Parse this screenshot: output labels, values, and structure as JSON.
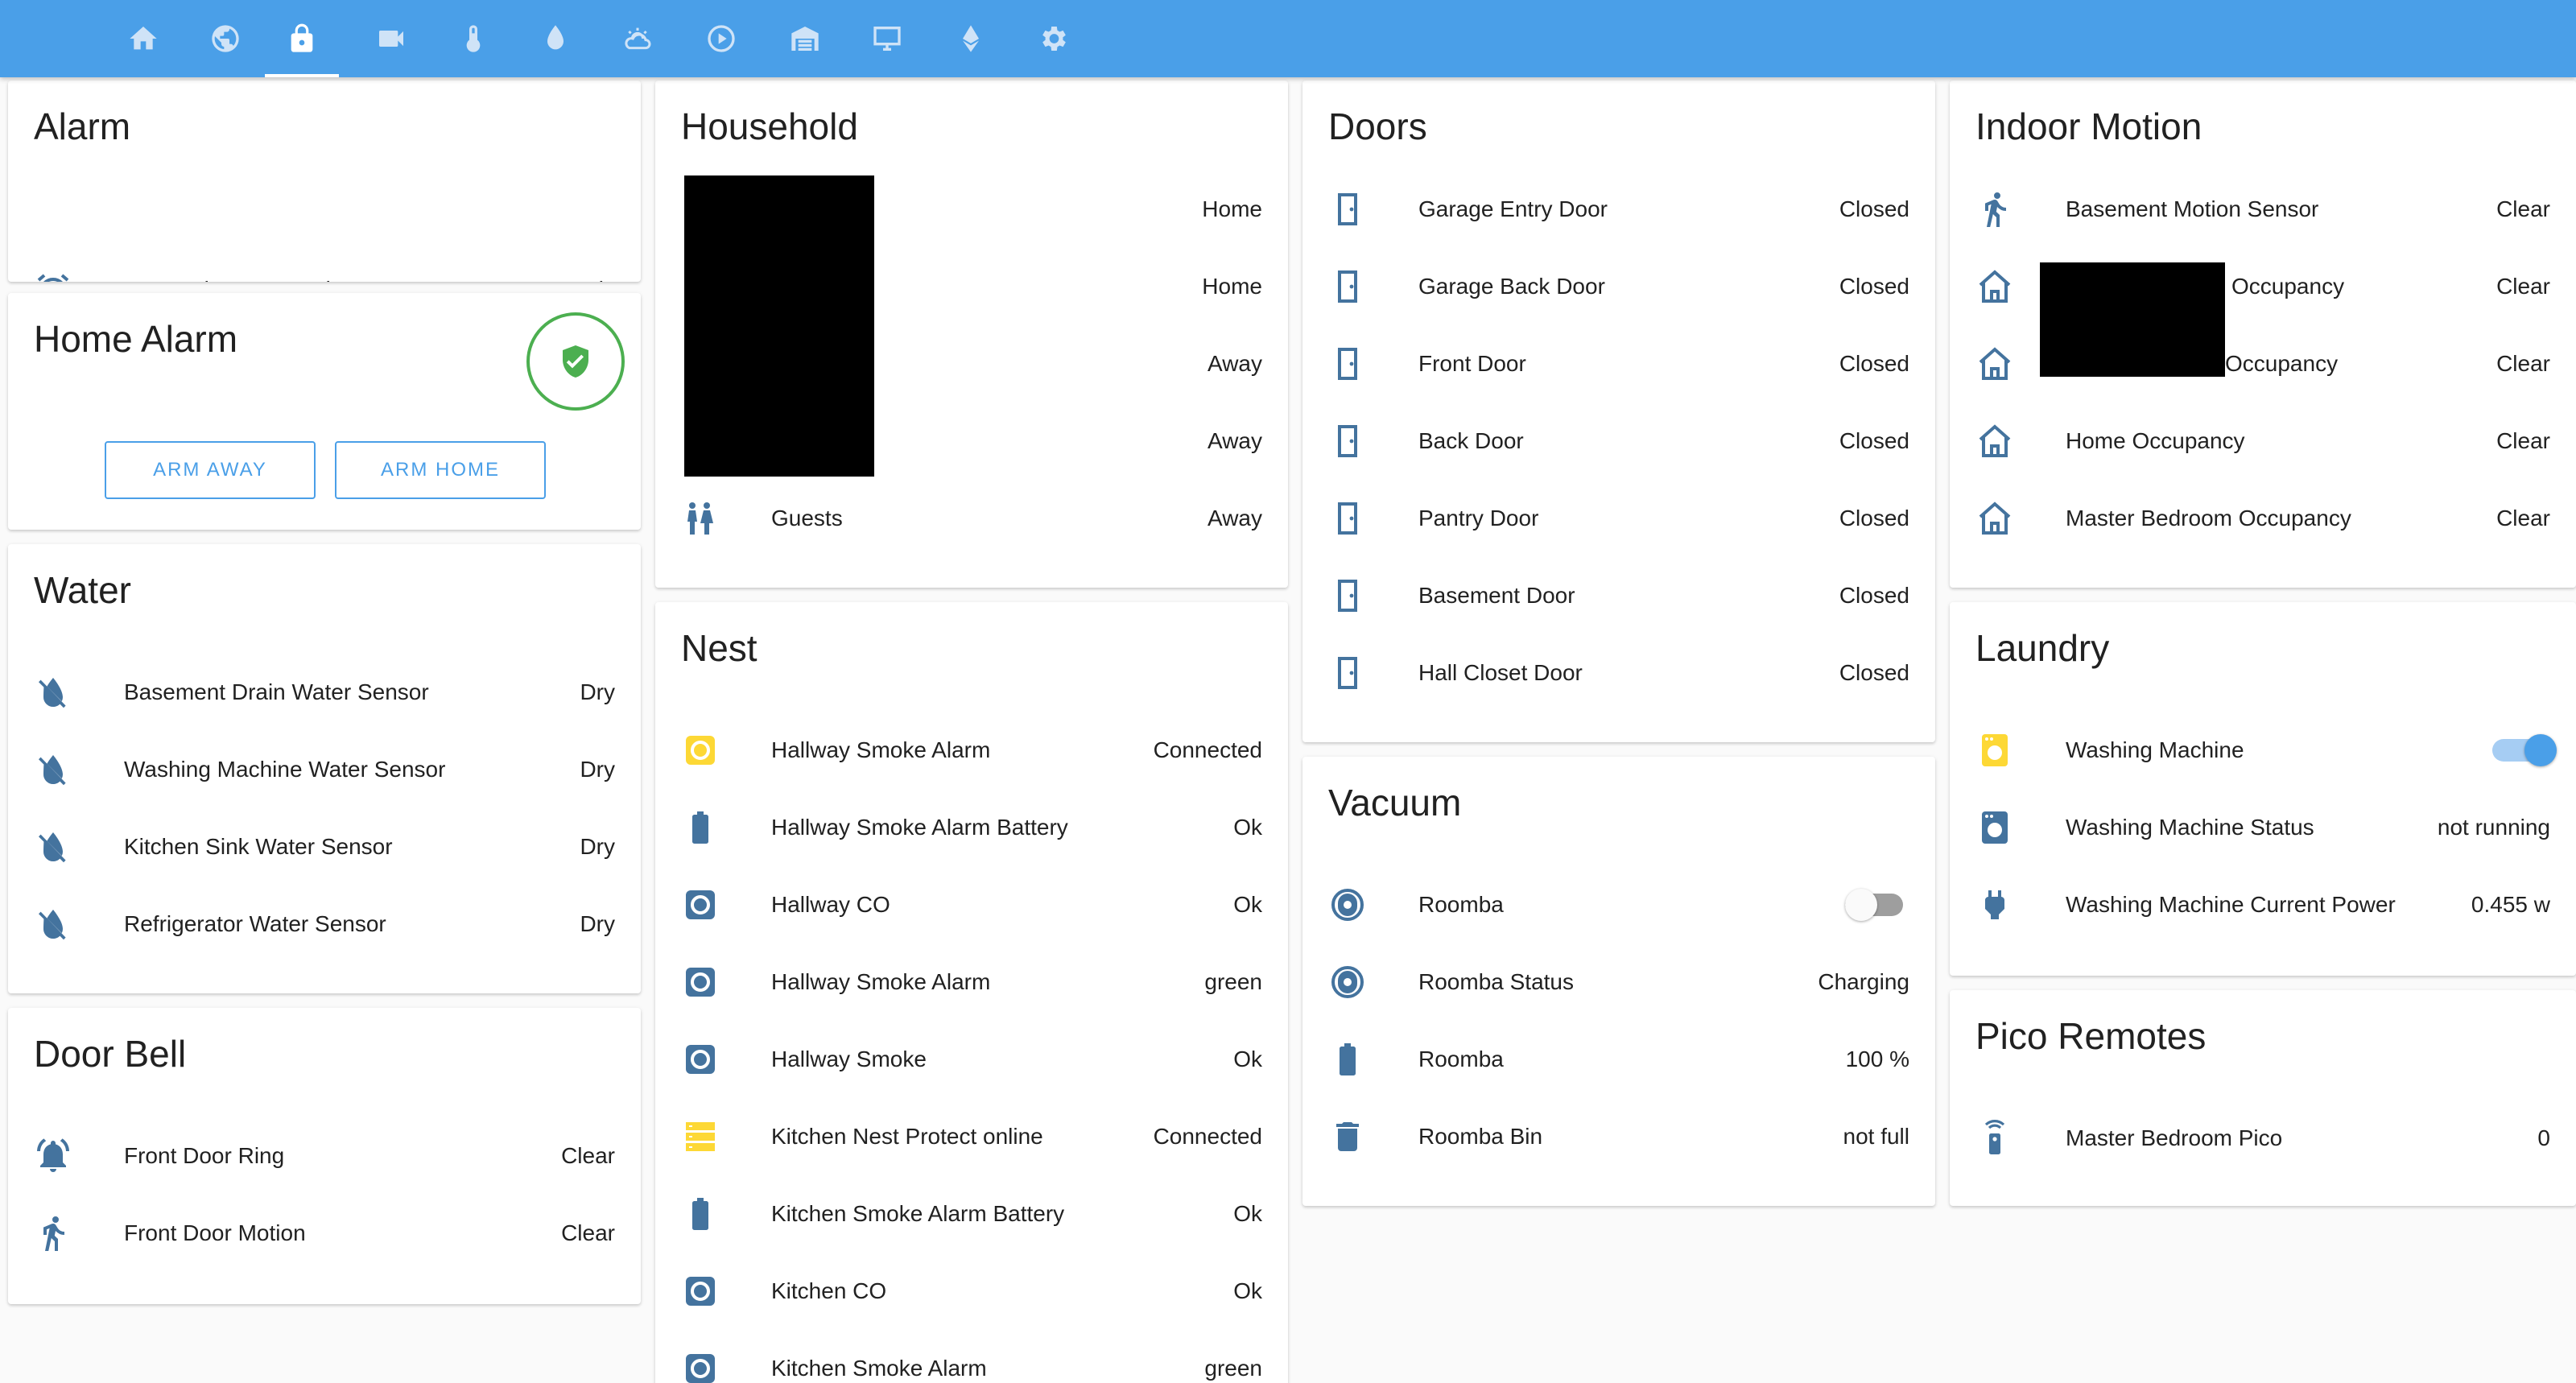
{
  "colors": {
    "accent": "#4a9fe8",
    "icon": "#44739e",
    "alarm_green": "#4caf50",
    "smoke_yellow": "#fdd835"
  },
  "nav": {
    "tabs": [
      {
        "icon": "home-icon"
      },
      {
        "icon": "globe-icon"
      },
      {
        "icon": "lock-icon",
        "active": true
      },
      {
        "icon": "video-camera-icon"
      },
      {
        "icon": "thermometer-icon"
      },
      {
        "icon": "water-drop-icon"
      },
      {
        "icon": "weather-partly-cloudy-icon"
      },
      {
        "icon": "play-circle-icon"
      },
      {
        "icon": "garage-icon"
      },
      {
        "icon": "monitor-icon"
      },
      {
        "icon": "ethereum-icon"
      },
      {
        "icon": "gear-icon"
      }
    ]
  },
  "alarm": {
    "title": "Alarm",
    "rows": [
      {
        "name": "Home Alarm Keypad",
        "state": "Ready",
        "icon": "alarm-clock-icon"
      }
    ]
  },
  "home_alarm": {
    "title": "Home Alarm",
    "status_icon": "shield-check-icon",
    "arm_away": "ARM AWAY",
    "arm_home": "ARM HOME"
  },
  "water": {
    "title": "Water",
    "rows": [
      {
        "name": "Basement Drain Water Sensor",
        "state": "Dry",
        "icon": "water-off-icon"
      },
      {
        "name": "Washing Machine Water Sensor",
        "state": "Dry",
        "icon": "water-off-icon"
      },
      {
        "name": "Kitchen Sink Water Sensor",
        "state": "Dry",
        "icon": "water-off-icon"
      },
      {
        "name": "Refrigerator Water Sensor",
        "state": "Dry",
        "icon": "water-off-icon"
      }
    ]
  },
  "door_bell": {
    "title": "Door Bell",
    "rows": [
      {
        "name": "Front Door Ring",
        "state": "Clear",
        "icon": "bell-ring-icon"
      },
      {
        "name": "Front Door Motion",
        "state": "Clear",
        "icon": "walking-person-icon"
      }
    ]
  },
  "household": {
    "title": "Household",
    "rows": [
      {
        "name": "",
        "state": "Home"
      },
      {
        "name": "",
        "state": "Home"
      },
      {
        "name": "",
        "state": "Away"
      },
      {
        "name": "",
        "state": "Away"
      },
      {
        "name": "Guests",
        "state": "Away",
        "icon": "guests-icon"
      }
    ]
  },
  "nest": {
    "title": "Nest",
    "rows": [
      {
        "name": "Hallway Smoke Alarm",
        "state": "Connected",
        "icon": "smoke-detector-icon"
      },
      {
        "name": "Hallway Smoke Alarm Battery",
        "state": "Ok",
        "icon": "battery-icon"
      },
      {
        "name": "Hallway CO",
        "state": "Ok",
        "icon": "smoke-detector-icon"
      },
      {
        "name": "Hallway Smoke Alarm",
        "state": "green",
        "icon": "smoke-detector-icon"
      },
      {
        "name": "Hallway Smoke",
        "state": "Ok",
        "icon": "smoke-detector-icon"
      },
      {
        "name": "Kitchen Nest Protect online",
        "state": "Connected",
        "icon": "server-icon"
      },
      {
        "name": "Kitchen Smoke Alarm Battery",
        "state": "Ok",
        "icon": "battery-icon"
      },
      {
        "name": "Kitchen CO",
        "state": "Ok",
        "icon": "smoke-detector-icon"
      },
      {
        "name": "Kitchen Smoke Alarm",
        "state": "green",
        "icon": "smoke-detector-icon"
      }
    ]
  },
  "doors": {
    "title": "Doors",
    "rows": [
      {
        "name": "Garage Entry Door",
        "state": "Closed",
        "icon": "door-closed-icon"
      },
      {
        "name": "Garage Back Door",
        "state": "Closed",
        "icon": "door-closed-icon"
      },
      {
        "name": "Front Door",
        "state": "Closed",
        "icon": "door-closed-icon"
      },
      {
        "name": "Back Door",
        "state": "Closed",
        "icon": "door-closed-icon"
      },
      {
        "name": "Pantry Door",
        "state": "Closed",
        "icon": "door-closed-icon"
      },
      {
        "name": "Basement Door",
        "state": "Closed",
        "icon": "door-closed-icon"
      },
      {
        "name": "Hall Closet Door",
        "state": "Closed",
        "icon": "door-closed-icon"
      }
    ]
  },
  "vacuum": {
    "title": "Vacuum",
    "rows": [
      {
        "name": "Roomba",
        "state": "",
        "icon": "robot-vacuum-icon",
        "toggle": false
      },
      {
        "name": "Roomba Status",
        "state": "Charging",
        "icon": "robot-vacuum-icon"
      },
      {
        "name": "Roomba",
        "state": "100 %",
        "icon": "battery-icon"
      },
      {
        "name": "Roomba Bin",
        "state": "not full",
        "icon": "trash-can-icon"
      }
    ]
  },
  "indoor_motion": {
    "title": "Indoor Motion",
    "rows": [
      {
        "name": "Basement Motion Sensor",
        "state": "Clear",
        "icon": "walking-person-icon"
      },
      {
        "name": "Occupancy",
        "state": "Clear",
        "icon": "home-outline-icon"
      },
      {
        "name": "Occupancy",
        "state": "Clear",
        "icon": "home-outline-icon"
      },
      {
        "name": "Home Occupancy",
        "state": "Clear",
        "icon": "home-outline-icon"
      },
      {
        "name": "Master Bedroom Occupancy",
        "state": "Clear",
        "icon": "home-outline-icon"
      }
    ]
  },
  "laundry": {
    "title": "Laundry",
    "rows": [
      {
        "name": "Washing Machine",
        "state": "",
        "icon": "washing-machine-icon",
        "toggle": true
      },
      {
        "name": "Washing Machine Status",
        "state": "not running",
        "icon": "washing-machine-icon"
      },
      {
        "name": "Washing Machine Current Power",
        "state": "0.455 w",
        "icon": "power-plug-icon"
      }
    ]
  },
  "pico": {
    "title": "Pico Remotes",
    "rows": [
      {
        "name": "Master Bedroom Pico",
        "state": "0",
        "icon": "remote-icon"
      }
    ]
  }
}
